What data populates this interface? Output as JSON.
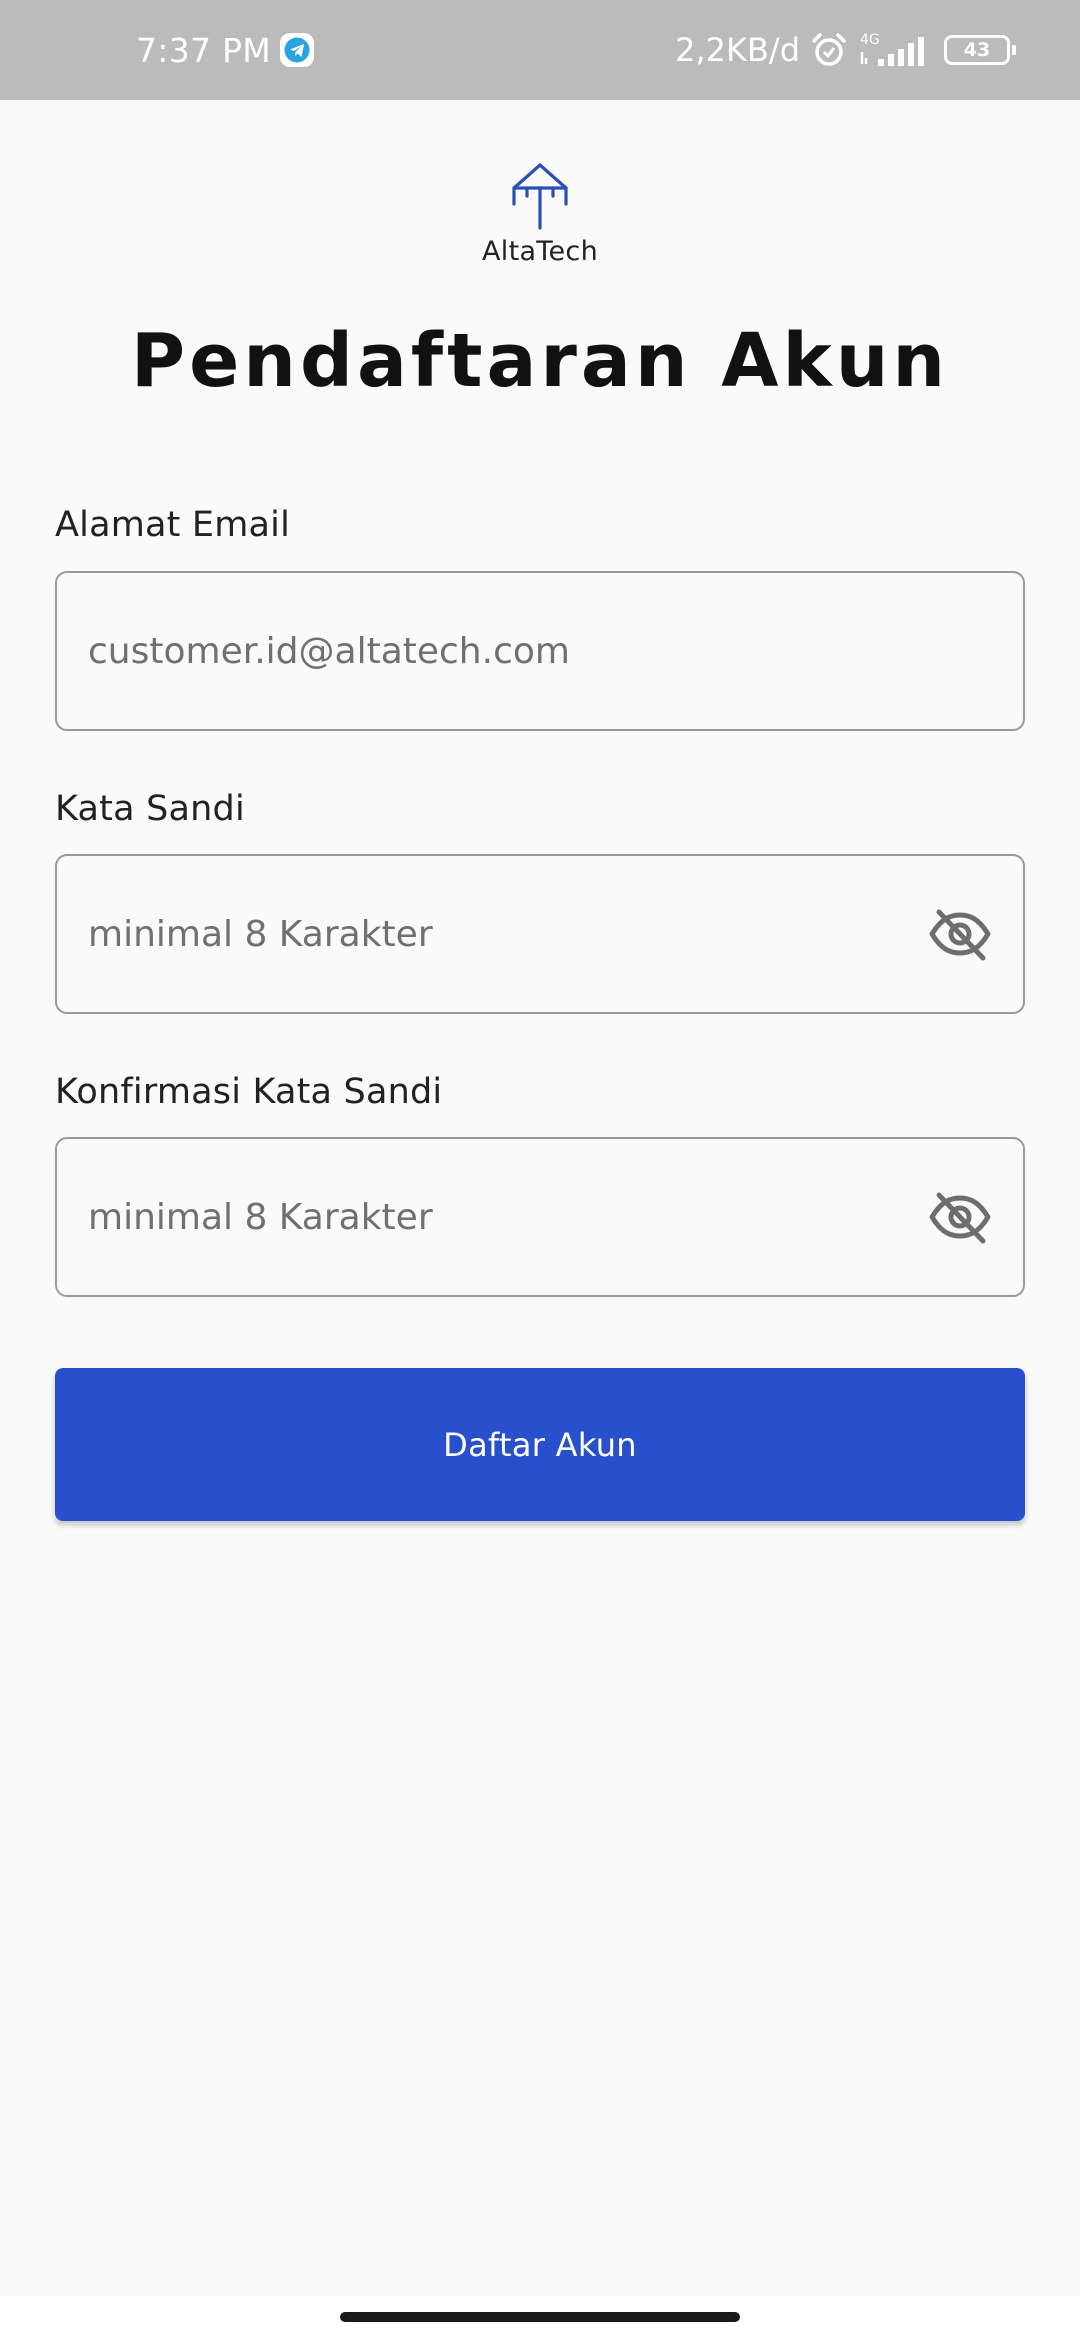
{
  "status_bar": {
    "time": "7:37 PM",
    "network_speed": "2,2KB/d",
    "network_type": "4G",
    "battery_level": "43",
    "icons": [
      "telegram-icon",
      "alarm-icon",
      "signal-icon",
      "battery-icon"
    ]
  },
  "logo": {
    "name": "AltaTech",
    "icon": "altatech-logo-icon"
  },
  "page_title": "Pendaftaran Akun",
  "form": {
    "email": {
      "label": "Alamat Email",
      "placeholder": "customer.id@altatech.com",
      "value": ""
    },
    "password": {
      "label": "Kata Sandi",
      "placeholder": "minimal 8 Karakter",
      "value": "",
      "toggle_icon": "eye-off-icon"
    },
    "confirm_password": {
      "label": "Konfirmasi Kata Sandi",
      "placeholder": "minimal 8 Karakter",
      "value": "",
      "toggle_icon": "eye-off-icon"
    },
    "submit_label": "Daftar Akun"
  },
  "colors": {
    "primary": "#2850CC",
    "logo": "#2A4FB8",
    "status_bar": "#BBBBBB",
    "background": "#FAFAFA",
    "border": "#9A9A9A"
  }
}
